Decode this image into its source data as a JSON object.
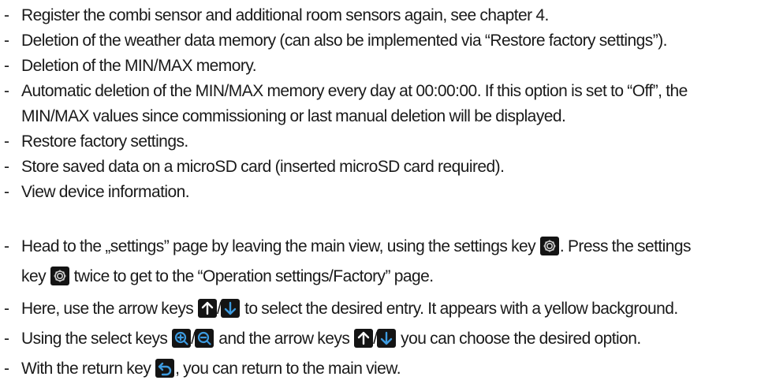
{
  "top_list": {
    "items": [
      "Register the combi sensor and additional room sensors again, see chapter 4.",
      "Deletion of the weather data memory (can also be implemented via “Restore factory settings”).",
      "Deletion of the MIN/MAX memory."
    ],
    "auto_delete": {
      "line1": "Automatic deletion of the MIN/MAX memory every day at 00:00:00. If this option is set to “Off”, the",
      "line2": "MIN/MAX values since commissioning or last manual deletion will be displayed."
    },
    "items_after": [
      "Restore factory settings.",
      "Store saved data on a microSD card (inserted microSD card required).",
      "View device information."
    ]
  },
  "instructions": {
    "settings": {
      "part1": "Head to the „settings” page by leaving the main view, using the settings key ",
      "part2": ". Press the settings",
      "part3": "key ",
      "part4": " twice to get to the “Operation settings/Factory” page."
    },
    "arrows": {
      "part1": "Here, use the arrow keys ",
      "separator": "/",
      "part2": " to select the desired entry. It appears with a yellow background."
    },
    "select": {
      "part1": "Using the select keys ",
      "separator": "/",
      "part2": " and the arrow keys ",
      "separator2": "/",
      "part3": " you can choose the desired option."
    },
    "return": {
      "part1": "With the return key ",
      "part2": ", you can return to the main view."
    }
  },
  "bullet": "-",
  "icons": {
    "settings": "gear-icon",
    "arrow_up": "arrow-up-icon",
    "arrow_down": "arrow-down-icon",
    "zoom_in": "zoom-in-icon",
    "zoom_out": "zoom-out-icon",
    "return": "return-icon",
    "accent_color": "#3d9be0",
    "key_background": "#141414"
  }
}
